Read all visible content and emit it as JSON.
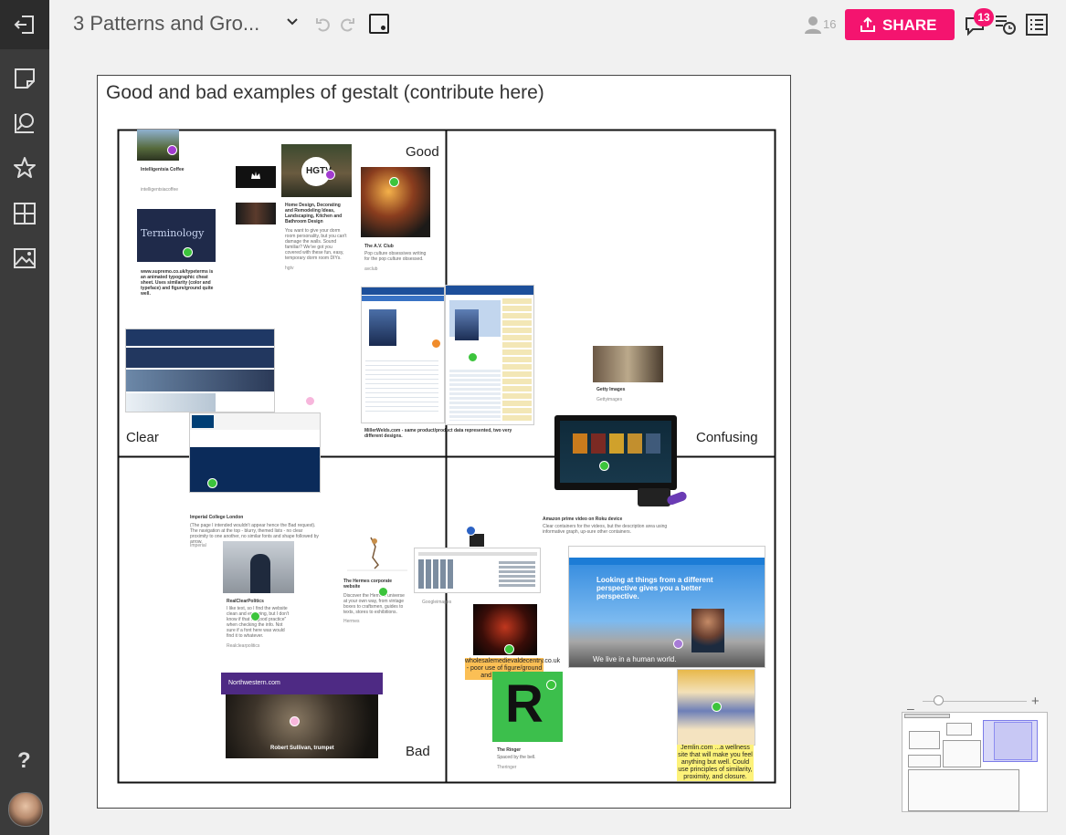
{
  "header": {
    "board_title": "3 Patterns and Gro...",
    "collaborator_count": "16",
    "share_label": "SHARE",
    "comment_badge": "13"
  },
  "sidebar": {
    "help_label": "?"
  },
  "section": {
    "title": "Good and bad examples of gestalt (contribute here)",
    "axis_labels": {
      "good": "Good",
      "bad": "Bad",
      "clear": "Clear",
      "confusing": "Confusing"
    }
  },
  "cards": {
    "intelligentsia": {
      "title": "Intelligentsia Coffee",
      "source": "intelligentsiacoffee"
    },
    "hgtv": {
      "title": "Home Design, Decorating and Remodeling Ideas, Landscaping, Kitchen and Bathroom Design",
      "desc": "You want to give your dorm room personality, but you can't damage the walls. Sound familiar? We've got you covered with these fun, easy, temporary dorm room DIYs.",
      "source": "hgtv"
    },
    "avclub": {
      "title": "The A.V. Club",
      "desc": "Pop culture obsessives writing for the pop culture obsessed.",
      "source": "avclub"
    },
    "typeterms": {
      "logo": "Terminology",
      "desc": "www.supremo.co.uk/typeterms is an animated typographic cheat sheet. Uses similarity (color and typeface) and figure/ground quite well."
    },
    "millerwelds": {
      "desc": "MillerWelds.com - same product/product data represented, two very different designs."
    },
    "getty": {
      "title": "Getty Images",
      "source": "Gettyimages"
    },
    "imperial": {
      "title": "Imperial College London",
      "desc": "(The page I intended wouldn't appear hence the Bad request). The navigation at the top - blurry, themed lists - no clear proximity to one another, no similar fonts and shape followed by arrow.",
      "source": "Imperial"
    },
    "amazon": {
      "title": "Amazon prime video on Roku device",
      "desc": "Clear containers for the videos, but the description area using informative graph, up-sure other containers."
    },
    "realclear": {
      "title": "RealClearPolitics",
      "desc": "I like text, so I find the website clean and engaging, but I don't know if that is \"good practice\" when checking the info. Not sure if a font here was would find it to whatever.",
      "source": "Realclearpolitics"
    },
    "hermes": {
      "title": "The Hermes corporate website",
      "desc": "Discover the Hermes universe at your own way, from vintage boxes to craftsmen, guides to texts, stores to exhibitions.",
      "source": "Hermes"
    },
    "googleimages": {
      "source": "Googleimages"
    },
    "wholesale": {
      "sticky": "wholesalemedievaldecentry.co.uk - poor use of figure/ground and continuation"
    },
    "healthwealth": {
      "headline": "Looking at things from a different perspective gives you a better perspective.",
      "tagline": "We live in a human world."
    },
    "ringer": {
      "title": "The Ringer",
      "desc": "Spaced by the bell.",
      "source": "Theringer"
    },
    "jemlin": {
      "sticky": "Jemlin.com ...a wellness site that will make you feel anything but well. Could use principles of similarity, proximity, and closure."
    },
    "northwestern": {
      "header": "Northwestern.com",
      "caption": "Robert Sullivan, trumpet"
    }
  },
  "colors": {
    "share": "#f4146f",
    "rail": "#3b3b3b",
    "sticky_yellow": "#fdf27a",
    "sticky_orange": "#fbbf55"
  }
}
